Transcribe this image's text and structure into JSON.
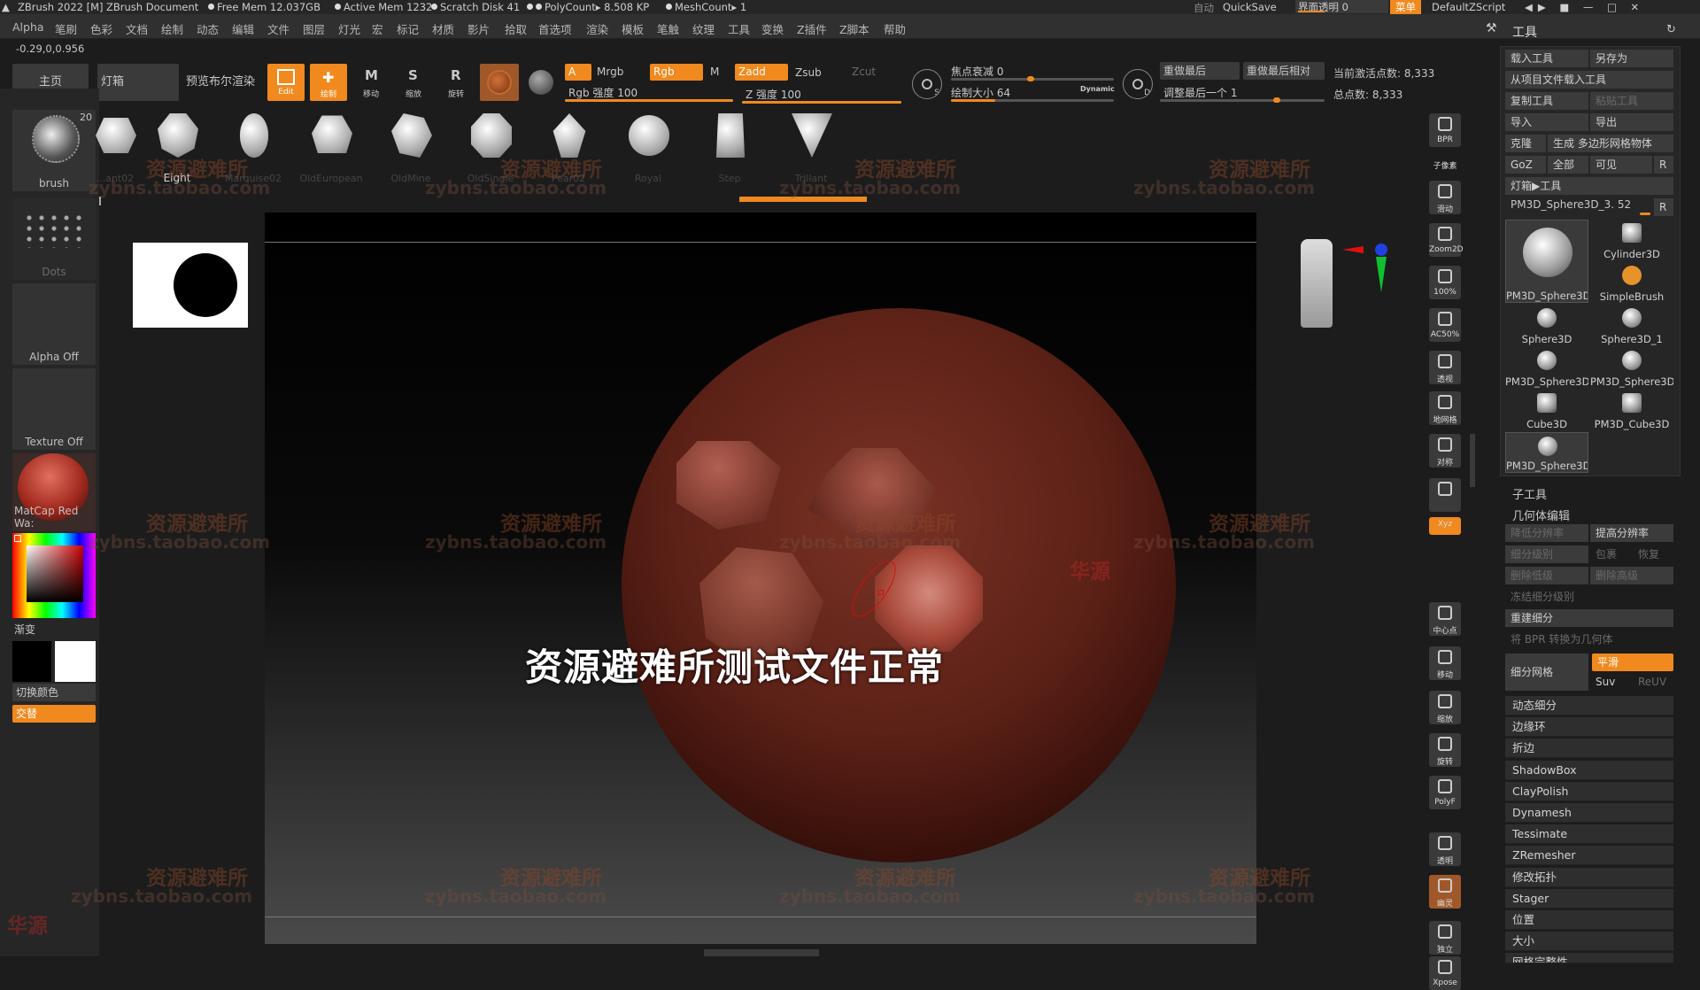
{
  "titlebar": {
    "app": "ZBrush 2022 [M]",
    "doc": "ZBrush Document",
    "free_mem": "Free Mem 12.037GB",
    "active_mem": "Active Mem 1232",
    "scratch": "Scratch Disk 41",
    "polycount": "PolyCount▸ 8.508 KP",
    "meshcount": "MeshCount▸ 1",
    "auto": "自动",
    "quicksave": "QuickSave",
    "transparency": "界面透明 0",
    "menu": "菜单",
    "script": "DefaultZScript"
  },
  "menubar": [
    "Alpha",
    "笔刷",
    "色彩",
    "文档",
    "绘制",
    "动态",
    "编辑",
    "文件",
    "图层",
    "灯光",
    "宏",
    "标记",
    "材质",
    "影片",
    "拾取",
    "首选项",
    "渲染",
    "模板",
    "笔触",
    "纹理",
    "工具",
    "变换",
    "Z插件",
    "Z脚本",
    "帮助"
  ],
  "coords": "-0.29,0,0.956",
  "toolbar": {
    "home": "主页",
    "lightbox": "灯箱",
    "preview_bool": "预览布尔渲染",
    "edit": "Edit",
    "draw": "绘制",
    "move": "移动",
    "scale": "缩放",
    "rotate": "旋转",
    "a": "A",
    "mrgb": "Mrgb",
    "rgb": "Rgb",
    "m": "M",
    "zadd": "Zadd",
    "zsub": "Zsub",
    "zcut": "Zcut",
    "rgb_intensity": "Rgb 强度 100",
    "z_intensity": "Z 强度 100",
    "focal_shift": "焦点衰减 0",
    "draw_size": "绘制大小 64",
    "dynamic": "Dynamic",
    "redo_last": "重做最后",
    "redo_last_rel": "重做最后相对",
    "adjust_last": "调整最后一个 1",
    "active_points": "当前激活点数: 8,333",
    "total_points": "总点数: 8,333",
    "s_label": "S",
    "d_label": "D"
  },
  "left": {
    "brush_label": "brush",
    "brush_count": "20",
    "stroke_label": "Dots",
    "alpha_label": "Alpha Off",
    "texture_label": "Texture Off",
    "material_label": "MatCap Red Wa:",
    "gradient_label": "渐变",
    "switch_color": "切换颜色",
    "alternate": "交替"
  },
  "brushes": [
    "...ant02",
    "Eight",
    "Marquise02",
    "OldEuropean",
    "OldMine",
    "OldSingle",
    "Pear02",
    "Royal",
    "Step",
    "Trillant"
  ],
  "viewport": {
    "overlay_text": "资源避难所测试文件正常",
    "watermark1": "资源避难所",
    "watermark2": "zybns.taobao.com",
    "watermark3": "华源"
  },
  "rightbar": [
    "BPR",
    "子像素",
    "滑动",
    "Zoom2D",
    "100%",
    "AC50%",
    "透视",
    "地网格",
    "对称",
    "",
    "Xyz",
    "",
    "",
    "中心点",
    "移动",
    "缩放",
    "旋转",
    "PolyF",
    "透明",
    "幽灵",
    "独立",
    "Xpose"
  ],
  "toolpanel": {
    "title": "工具",
    "load_tool": "载入工具",
    "save_as": "另存为",
    "load_from_project": "从项目文件载入工具",
    "copy_tool": "复制工具",
    "paste_tool": "粘贴工具",
    "import": "导入",
    "export": "导出",
    "clone": "克隆",
    "make_polymesh": "生成 多边形网格物体",
    "goz": "GoZ",
    "all": "全部",
    "visible": "可见",
    "r": "R",
    "lightbox_tools": "灯箱▶工具",
    "current_tool": "PM3D_Sphere3D_3. 52",
    "thumbs": [
      "PM3D_Sphere3D",
      "Cylinder3D",
      "SimpleBrush",
      "Sphere3D",
      "Sphere3D_1",
      "PM3D_Sphere3D",
      "PM3D_Sphere3D",
      "Cube3D",
      "PM3D_Cube3D",
      "PM3D_Sphere3D"
    ],
    "subtool": "子工具",
    "geometry": "几何体编辑",
    "lower_res": "降低分辨率",
    "higher_res": "提高分辨率",
    "sdiv": "细分级别",
    "cage": "包裹",
    "restore": "恢复",
    "del_lower": "删除低级",
    "del_higher": "删除高级",
    "freeze_sdiv": "冻结细分级别",
    "reconstruct": "重建细分",
    "bpr_to_geo": "将 BPR 转换为几何体",
    "divide": "细分网格",
    "smooth": "平滑",
    "suv": "Suv",
    "reuv": "ReUV",
    "items": [
      "动态细分",
      "边缘环",
      "折边",
      "ShadowBox",
      "ClayPolish",
      "Dynamesh",
      "Tessimate",
      "ZRemesher",
      "修改拓扑",
      "Stager",
      "位置",
      "大小",
      "网格完整性"
    ]
  }
}
